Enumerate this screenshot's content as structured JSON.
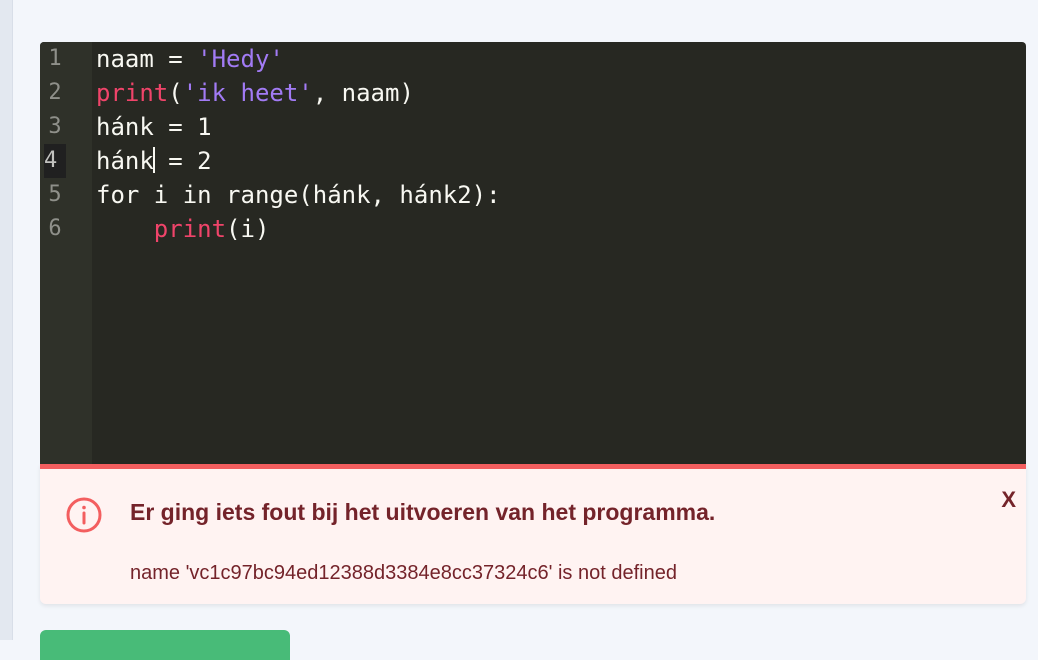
{
  "editor": {
    "line_numbers": [
      "1",
      "2",
      "3",
      "4",
      "5",
      "6"
    ],
    "lines": [
      [
        {
          "t": "naam = ",
          "c": "plain"
        },
        {
          "t": "'Hedy'",
          "c": "str"
        }
      ],
      [
        {
          "t": "print",
          "c": "kw"
        },
        {
          "t": "(",
          "c": "plain"
        },
        {
          "t": "'ik heet'",
          "c": "str"
        },
        {
          "t": ", naam)",
          "c": "plain"
        }
      ],
      [
        {
          "t": "hánk = 1",
          "c": "plain"
        }
      ],
      [
        {
          "t": "hánk",
          "c": "plain"
        },
        {
          "t": "",
          "c": "cursor"
        },
        {
          "t": " = 2",
          "c": "plain"
        }
      ],
      [
        {
          "t": "for i in range(hánk, hánk2):",
          "c": "plain"
        }
      ],
      [
        {
          "t": "    ",
          "c": "plain"
        },
        {
          "t": "print",
          "c": "kw"
        },
        {
          "t": "(i)",
          "c": "plain"
        }
      ]
    ],
    "active_line": 4
  },
  "error": {
    "title": "Er ging iets fout bij het uitvoeren van het programma.",
    "message": "name 'vc1c97bc94ed12388d3384e8cc37324c6' is not defined",
    "close_label": "X",
    "icon": "alert-circle-icon",
    "accent_color": "#f35e5f"
  },
  "colors": {
    "editor_bg": "#272822",
    "keyword": "#f0446a",
    "string": "#a27bf5",
    "error_text": "#74232a",
    "run_button": "#48bb78"
  }
}
